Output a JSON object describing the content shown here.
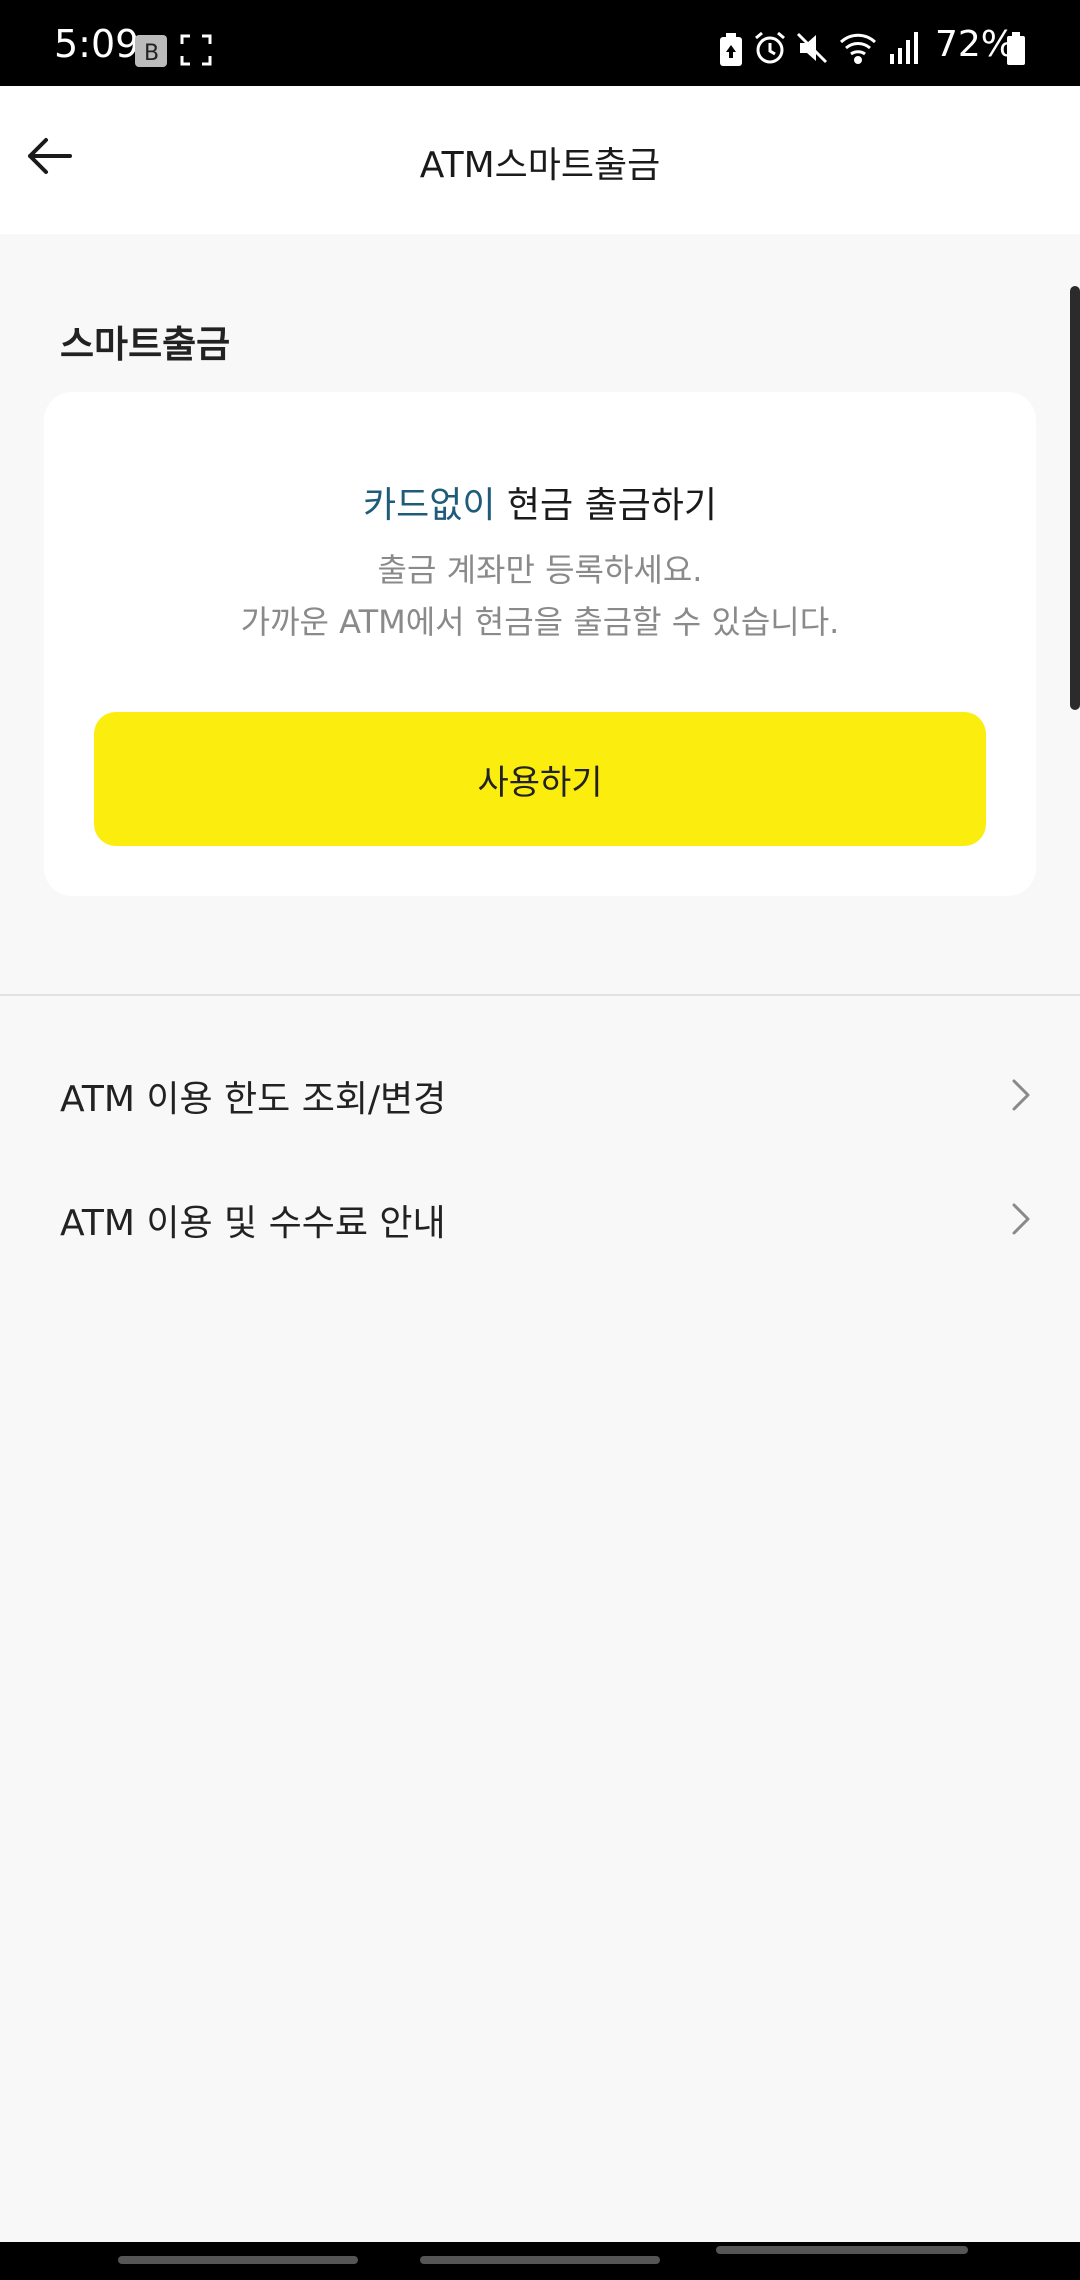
{
  "status_bar": {
    "time": "5:09",
    "battery_percent": "72%",
    "icons": [
      "b-app-icon",
      "screenshot-icon",
      "battery-saver-icon",
      "alarm-icon",
      "mute-icon",
      "wifi-icon",
      "signal-icon",
      "battery-icon"
    ]
  },
  "header": {
    "title": "ATM스마트출금",
    "back_icon": "arrow-left-icon"
  },
  "section": {
    "title": "스마트출금"
  },
  "card": {
    "headline_accent": "카드없이",
    "headline_rest": " 현금 출금하기",
    "desc_line1": "출금 계좌만 등록하세요.",
    "desc_line2": "가까운 ATM에서 현금을 출금할 수 있습니다.",
    "button_label": "사용하기",
    "accent_color": "#1f5c7a",
    "button_color": "#fbed0e"
  },
  "menu": {
    "items": [
      {
        "label": "ATM 이용 한도 조회/변경",
        "icon": "chevron-right-icon"
      },
      {
        "label": "ATM 이용 및 수수료 안내",
        "icon": "chevron-right-icon"
      }
    ]
  }
}
